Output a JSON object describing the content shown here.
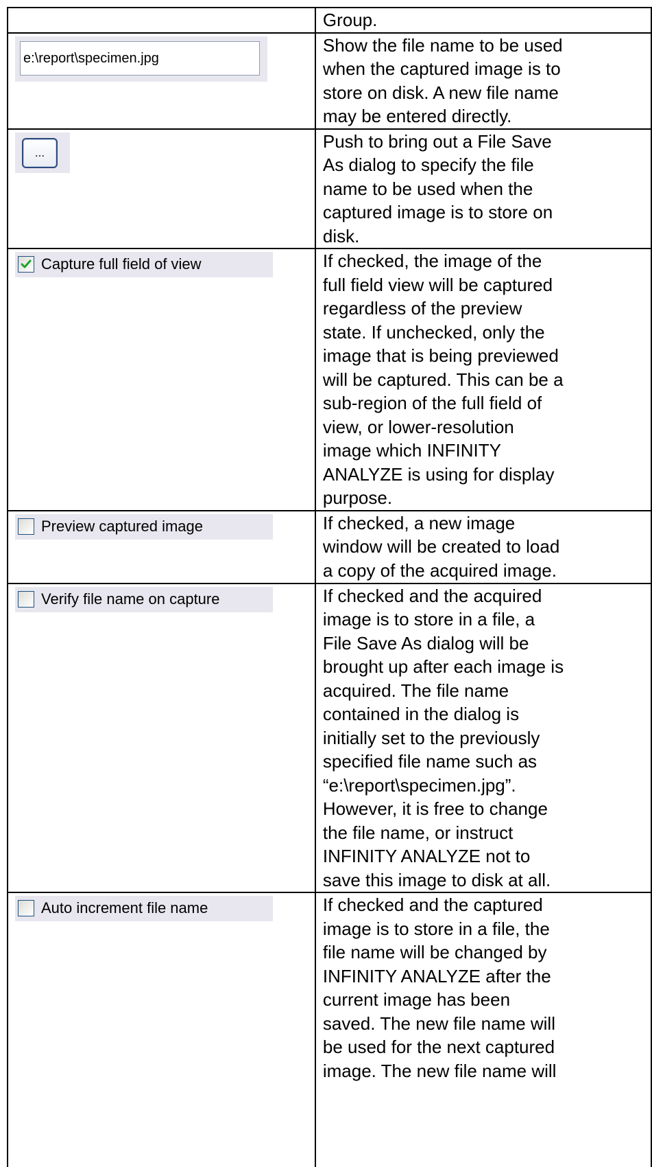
{
  "rows": [
    {
      "control": null,
      "description": "Group."
    },
    {
      "control": {
        "type": "text-input",
        "value": "e:\\report\\specimen.jpg"
      },
      "description": "Show the file name to be used\nwhen the captured image is to\nstore on disk. A new file name\nmay be entered directly."
    },
    {
      "control": {
        "type": "button",
        "label": "..."
      },
      "description": "Push to bring out a File Save\nAs dialog to specify the file\nname to be used when the\ncaptured image is to store on\ndisk."
    },
    {
      "control": {
        "type": "checkbox",
        "checked": true,
        "label": "Capture full field of view"
      },
      "description": "If checked, the image of the\nfull field view will be captured\nregardless of the preview\nstate. If unchecked, only the\nimage that is being previewed\nwill be captured. This can be a\nsub-region of the full field of\nview, or lower-resolution\nimage which INFINITY\nANALYZE is using for display\npurpose."
    },
    {
      "control": {
        "type": "checkbox",
        "checked": false,
        "label": "Preview captured image"
      },
      "description": "If checked, a new image\nwindow will be created to load\na copy of the acquired image."
    },
    {
      "control": {
        "type": "checkbox",
        "checked": false,
        "label": "Verify file name on capture"
      },
      "description": "If checked and the acquired\nimage is to store in a file, a\nFile Save As dialog will be\nbrought up after each image is\nacquired. The file name\ncontained in the dialog is\ninitially set to the previously\nspecified file name such as\n“e:\\report\\specimen.jpg”.\nHowever, it is free to change\nthe file name, or instruct\nINFINITY ANALYZE not to\nsave this image to disk at all."
    },
    {
      "control": {
        "type": "checkbox",
        "checked": false,
        "label": "Auto increment file name"
      },
      "description": "If checked and the captured\nimage is to store in a file, the\nfile name will be changed by\nINFINITY ANALYZE after the\ncurrent image has been\nsaved. The new file name will\nbe used for the next captured\nimage. The new file name will"
    }
  ],
  "colors": {
    "check_mark": "#1fa32a",
    "swatch_bg": "#e8e6ee",
    "button_border": "#2c4a7d"
  }
}
